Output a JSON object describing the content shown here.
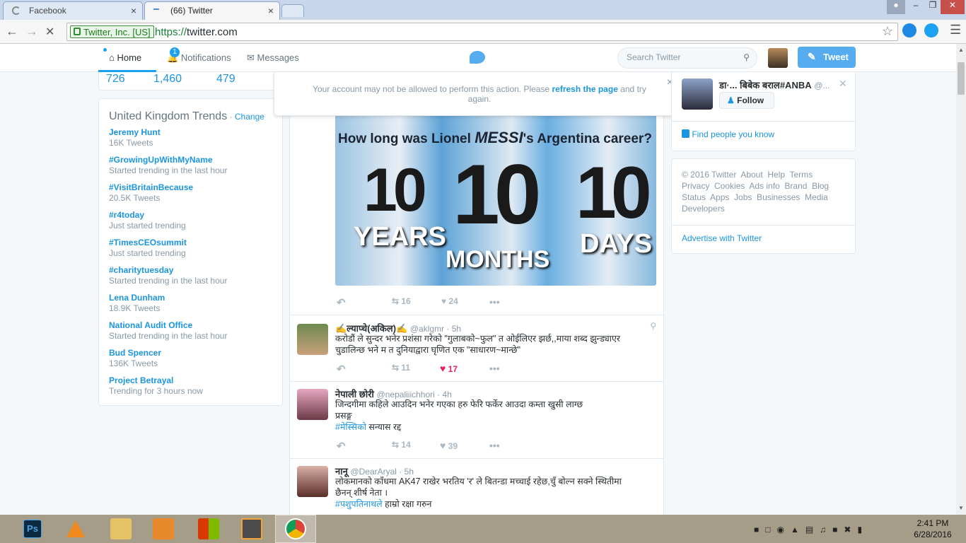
{
  "browser": {
    "tabs": [
      {
        "label": "Facebook",
        "close": "×"
      },
      {
        "label": "(66) Twitter",
        "close": "×"
      }
    ],
    "ev_label": "Twitter, Inc. [US]",
    "url_proto": "https://",
    "url_rest": "twitter.com"
  },
  "nav": {
    "home": "Home",
    "notifications": "Notifications",
    "notif_count": "1",
    "messages": "Messages",
    "search_placeholder": "Search Twitter",
    "tweet_btn": "Tweet"
  },
  "profile_counts": [
    "726",
    "1,460",
    "479"
  ],
  "trends": {
    "title": "United Kingdom Trends",
    "dot": " · ",
    "change": "Change",
    "items": [
      {
        "name": "Jeremy Hunt",
        "sub": "16K Tweets"
      },
      {
        "name": "#GrowingUpWithMyName",
        "sub": "Started trending in the last hour"
      },
      {
        "name": "#VisitBritainBecause",
        "sub": "20.5K Tweets"
      },
      {
        "name": "#r4today",
        "sub": "Just started trending"
      },
      {
        "name": "#TimesCEOsummit",
        "sub": "Just started trending"
      },
      {
        "name": "#charitytuesday",
        "sub": "Started trending in the last hour"
      },
      {
        "name": "Lena Dunham",
        "sub": "18.9K Tweets"
      },
      {
        "name": "National Audit Office",
        "sub": "Started trending in the last hour"
      },
      {
        "name": "Bud Spencer",
        "sub": "136K Tweets"
      },
      {
        "name": "Project Betrayal",
        "sub": "Trending for 3 hours now"
      }
    ]
  },
  "alert": {
    "text": "Your account may not be allowed to perform this action. Please ",
    "link": "refresh the page",
    "text2": " and try",
    "text3": "again.",
    "close": "×"
  },
  "image": {
    "headline_a": "How long was Lionel ",
    "headline_b": "MESSI",
    "headline_c": "'s Argentina career?",
    "n1": "10",
    "l1": "YEARS",
    "n2": "10",
    "l2": "MONTHS",
    "n3": "10",
    "l3": "DAYS"
  },
  "first_actions": {
    "rt": "16",
    "like": "24"
  },
  "tweets": [
    {
      "name": "✍ल्याप्चे(अकिल)✍",
      "handle": "@aklgmr",
      "time": "5h",
      "line1": "करोडौं ले सुन्दर भनेर प्रशंसा गरेको \"गुलाबको~फुल\" त ओईलिएर झर्छ,,माया शब्द झुन्ड्याएर",
      "line2": "चुडालिन्छ भने म त दुनियाद्वारा घृणित एक \"साधारण~मान्छे\"",
      "rt": "11",
      "like": "17"
    },
    {
      "name": "नेपाली छोरी",
      "handle": "@nepaliiichhori",
      "time": "4h",
      "line1": "जिन्दगीमा कहिले आउदिन भनेर गएका हरु फेरि फर्केर आउदा कम्ता खुसी लाग्छ",
      "line2": "प्रसङ्ग",
      "hashtag": "#मेस्सिको",
      "rest": " सन्यास रद्द",
      "rt": "14",
      "like": "39"
    },
    {
      "name": "नानू",
      "handle": "@DearAryal",
      "time": "5h",
      "line1": "लोकमानको काँधमा AK47 राखेर भरतिय 'र' ले बितन्डा मच्चाई रहेछ,चुँ बोल्न सक्ने स्थितीमा",
      "line2": "छैनन् शीर्ष नेता ।",
      "hashtag": "#पशुपतिनाथले",
      "rest": " हाम्रो रक्षा गरुन"
    }
  ],
  "who_to_follow": {
    "name": "डा·... बिबेक बराल#ANBA",
    "handle": "@...",
    "follow": "Follow",
    "find": "Find people you know"
  },
  "footer": {
    "lines": [
      "© 2016 Twitter  About  Help  Terms",
      "Privacy  Cookies  Ads info  Brand  Blog",
      "Status  Apps  Jobs  Businesses  Media",
      "Developers"
    ],
    "advertise": "Advertise with Twitter"
  },
  "taskbar": {
    "time": "2:41 PM",
    "date": "6/28/2016"
  },
  "colors": {
    "twitter_blue": "#55acee",
    "link": "#1b95e0",
    "like_red": "#e0245e"
  }
}
